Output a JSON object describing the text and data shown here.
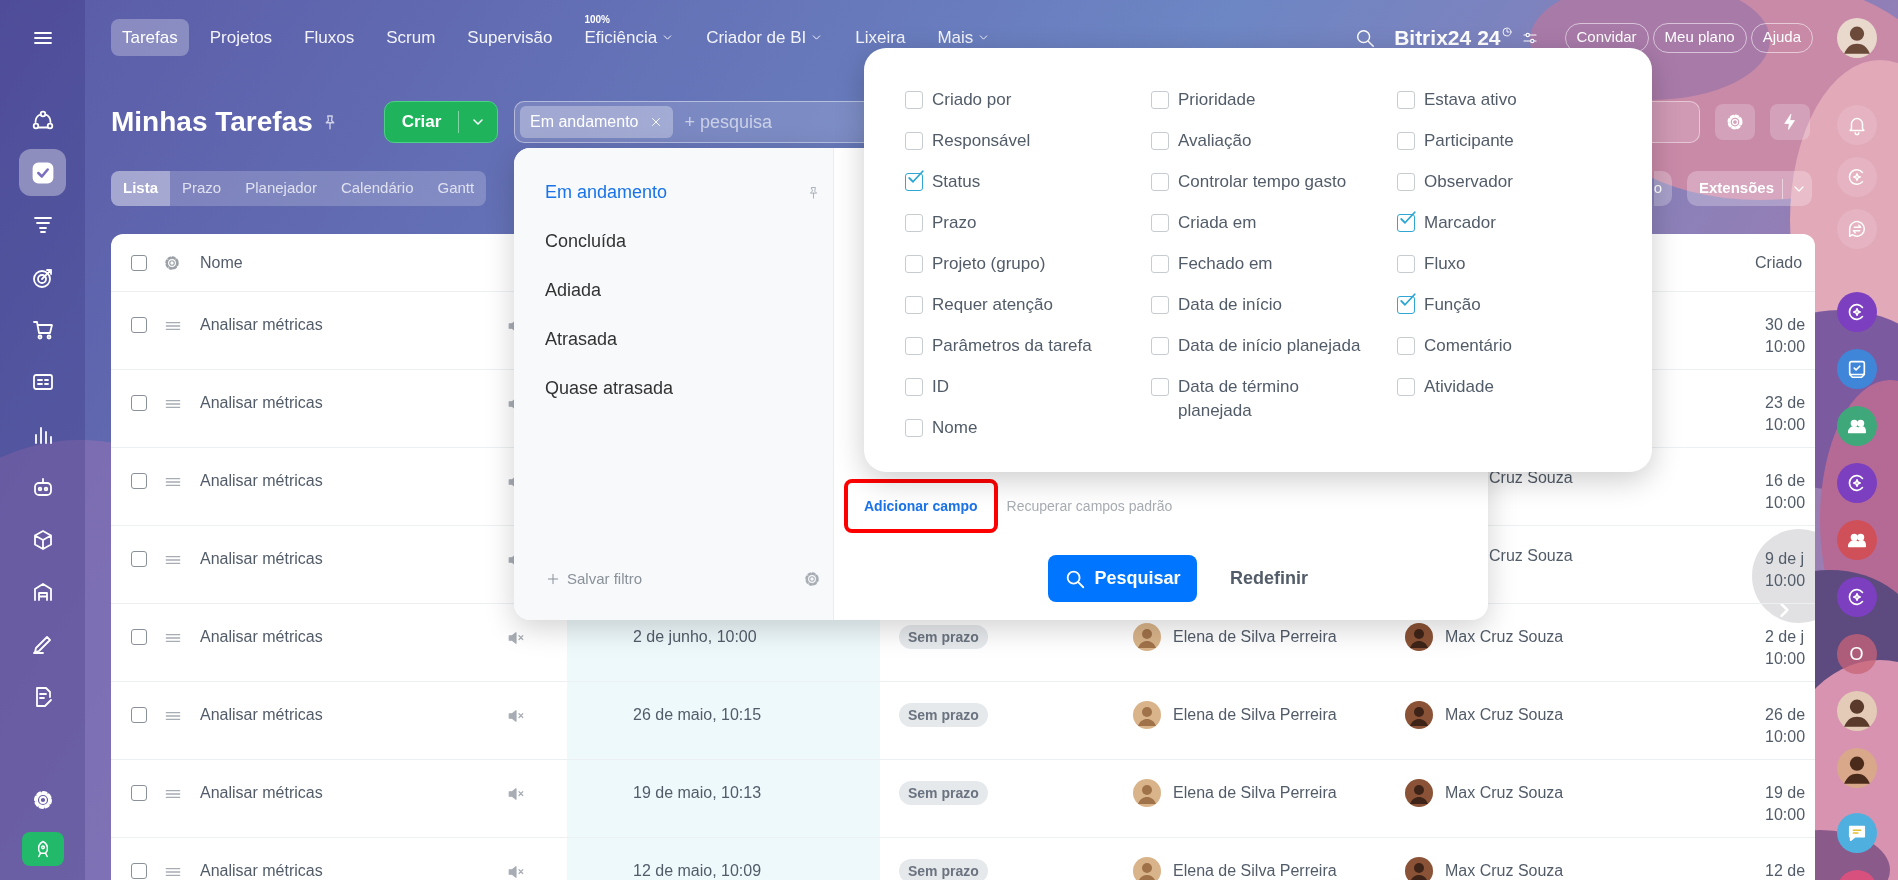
{
  "top_nav": {
    "items": [
      {
        "label": "Tarefas",
        "selected": true
      },
      {
        "label": "Projetos",
        "selected": false
      },
      {
        "label": "Fluxos",
        "selected": false
      },
      {
        "label": "Scrum",
        "selected": false
      },
      {
        "label": "Supervisão",
        "selected": false
      },
      {
        "label": "Eficiência",
        "selected": false,
        "dropdown": true,
        "badge": "100%"
      },
      {
        "label": "Criador de BI",
        "selected": false,
        "dropdown": true
      },
      {
        "label": "Lixeira",
        "selected": false
      },
      {
        "label": "Mais",
        "selected": false,
        "dropdown": true
      }
    ]
  },
  "header_right": {
    "logo": "Bitrix24",
    "logo_number": "24",
    "buttons": [
      "Convidar",
      "Meu plano",
      "Ajuda"
    ]
  },
  "sidebar": {
    "items": [
      {
        "selected": false
      },
      {
        "selected": true
      },
      {
        "selected": false
      },
      {
        "selected": false
      },
      {
        "selected": false
      },
      {
        "selected": false
      },
      {
        "selected": false
      },
      {
        "selected": false
      },
      {
        "selected": false
      },
      {
        "selected": false
      },
      {
        "selected": false
      },
      {
        "selected": false
      }
    ]
  },
  "page": {
    "title": "Minhas Tarefas",
    "create_button": "Criar",
    "search": {
      "chips": [
        "Em andamento"
      ],
      "placeholder": "+ pesquisa"
    },
    "view_tabs": [
      {
        "label": "Lista",
        "selected": true
      },
      {
        "label": "Prazo",
        "selected": false
      },
      {
        "label": "Planejador",
        "selected": false
      },
      {
        "label": "Calendário",
        "selected": false
      },
      {
        "label": "Gantt",
        "selected": false
      }
    ],
    "partial_button": "o",
    "extensions_button": "Extensões"
  },
  "table": {
    "columns": {
      "name": "Nome",
      "created": "Criado"
    },
    "all_checked": false,
    "rows": [
      {
        "name": "Analisar métricas",
        "checked": false,
        "muted": true,
        "created_date": "30 de",
        "created_time": "10:00"
      },
      {
        "name": "Analisar métricas",
        "checked": false,
        "muted": true,
        "created_date": "23 de",
        "created_time": "10:00"
      },
      {
        "name": "Analisar métricas",
        "checked": false,
        "muted": true,
        "responsible": "Cruz Souza",
        "avatar": false,
        "created_date": "16 de",
        "created_time": "10:00"
      },
      {
        "name": "Analisar métricas",
        "checked": false,
        "muted": true,
        "responsible": "Cruz Souza",
        "avatar": false,
        "created_date": "9 de j",
        "created_time": "10:00"
      },
      {
        "name": "Analisar métricas",
        "checked": false,
        "muted": true,
        "date": "2 de junho, 10:00",
        "deadline": "Sem prazo",
        "creator": "Elena de Silva Perreira",
        "responsible": "Max Cruz Souza",
        "avatar": true,
        "created_date": "2 de j",
        "created_time": "10:00"
      },
      {
        "name": "Analisar métricas",
        "checked": false,
        "muted": true,
        "date": "26 de maio, 10:15",
        "deadline": "Sem prazo",
        "creator": "Elena de Silva Perreira",
        "responsible": "Max Cruz Souza",
        "avatar": true,
        "created_date": "26 de",
        "created_time": "10:00"
      },
      {
        "name": "Analisar métricas",
        "checked": false,
        "muted": true,
        "date": "19 de maio, 10:13",
        "deadline": "Sem prazo",
        "creator": "Elena de Silva Perreira",
        "responsible": "Max Cruz Souza",
        "avatar": true,
        "created_date": "19 de",
        "created_time": "10:00"
      },
      {
        "name": "Analisar métricas",
        "checked": false,
        "muted": true,
        "date": "12 de maio, 10:09",
        "deadline": "Sem prazo",
        "creator": "Elena de Silva Perreira",
        "responsible": "Max Cruz Souza",
        "avatar": true,
        "created_date": "12 de"
      }
    ]
  },
  "filter_popup": {
    "presets": [
      {
        "label": "Em andamento",
        "selected": true,
        "pinned": true
      },
      {
        "label": "Concluída",
        "selected": false,
        "pinned": false
      },
      {
        "label": "Adiada",
        "selected": false,
        "pinned": false
      },
      {
        "label": "Atrasada",
        "selected": false,
        "pinned": false
      },
      {
        "label": "Quase atrasada",
        "selected": false,
        "pinned": false
      }
    ],
    "save_filter": "Salvar filtro",
    "add_field": {
      "label": "Adicionar campo",
      "highlighted": true
    },
    "restore_fields": "Recuperar campos padrão",
    "search_button": "Pesquisar",
    "reset_button": "Redefinir"
  },
  "field_selector": {
    "columns": [
      [
        {
          "label": "Criado por",
          "checked": false
        },
        {
          "label": "Responsável",
          "checked": false
        },
        {
          "label": "Status",
          "checked": true
        },
        {
          "label": "Prazo",
          "checked": false
        },
        {
          "label": "Projeto (grupo)",
          "checked": false
        },
        {
          "label": "Requer atenção",
          "checked": false
        },
        {
          "label": "Parâmetros da tarefa",
          "checked": false
        },
        {
          "label": "ID",
          "checked": false
        },
        {
          "label": "Nome",
          "checked": false
        }
      ],
      [
        {
          "label": "Prioridade",
          "checked": false
        },
        {
          "label": "Avaliação",
          "checked": false
        },
        {
          "label": "Controlar tempo gasto",
          "checked": false
        },
        {
          "label": "Criada em",
          "checked": false
        },
        {
          "label": "Fechado em",
          "checked": false
        },
        {
          "label": "Data de início",
          "checked": false
        },
        {
          "label": "Data de início planejada",
          "checked": false
        },
        {
          "label": "Data de término planejada",
          "checked": false
        }
      ],
      [
        {
          "label": "Estava ativo",
          "checked": false
        },
        {
          "label": "Participante",
          "checked": false
        },
        {
          "label": "Observador",
          "checked": false
        },
        {
          "label": "Marcador",
          "checked": true
        },
        {
          "label": "Fluxo",
          "checked": false
        },
        {
          "label": "Função",
          "checked": true
        },
        {
          "label": "Comentário",
          "checked": false
        },
        {
          "label": "Atividade",
          "checked": false
        }
      ]
    ]
  },
  "right_panel": {
    "letter_avatar": "O"
  }
}
